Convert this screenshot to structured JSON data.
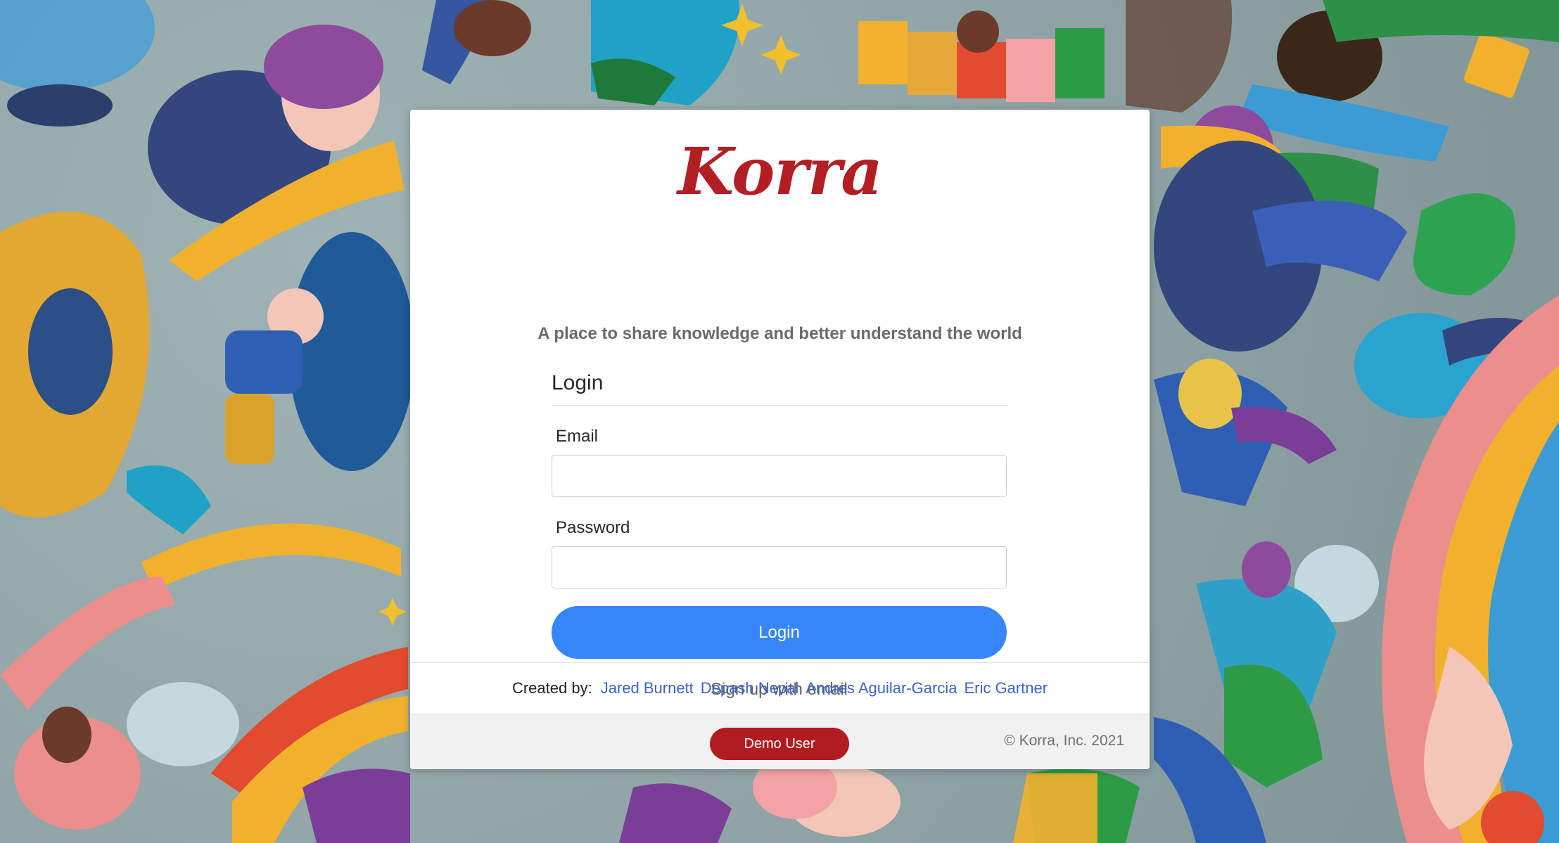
{
  "app": {
    "logo": "Korra",
    "tagline": "A place to share knowledge and better understand the world"
  },
  "login_form": {
    "title": "Login",
    "email_label": "Email",
    "email_value": "",
    "email_placeholder": "",
    "password_label": "Password",
    "password_value": "",
    "password_placeholder": "",
    "submit_label": "Login",
    "signup_link": "Sign up with email"
  },
  "creators": {
    "label": "Created by:",
    "names": [
      "Jared Burnett",
      "Depash Nepal",
      "Andres Aguilar-Garcia",
      "Eric Gartner"
    ]
  },
  "footer": {
    "demo_button": "Demo User",
    "copyright": "© Korra, Inc. 2021"
  },
  "colors": {
    "brand": "#b21e23",
    "primary_button": "#3686f9",
    "link": "#3b64c5",
    "demo_button": "#b01c20"
  }
}
